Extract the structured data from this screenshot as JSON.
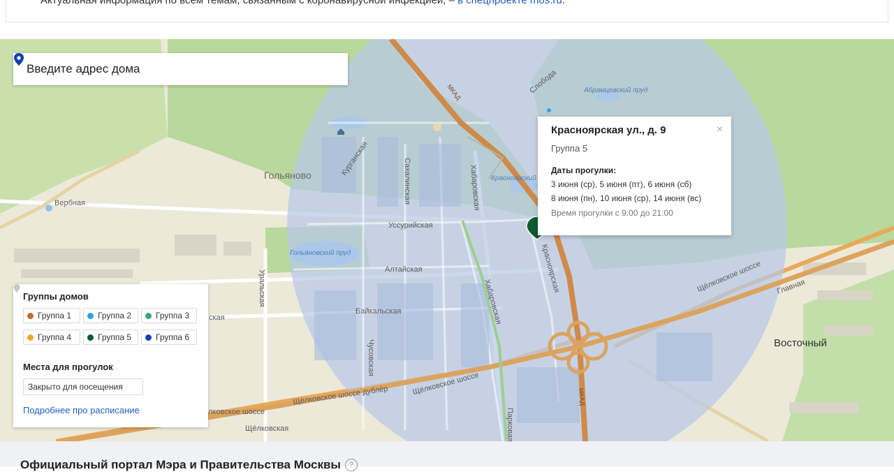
{
  "notice": {
    "text": "Актуальная информация по всем темам, связанным с коронавирусной инфекцией, –",
    "link": "в спецпроекте mos.ru",
    "tail": "."
  },
  "search": {
    "placeholder": "Введите адрес дома",
    "icon": "location-pin-icon"
  },
  "popup": {
    "title": "Красноярская ул., д. 9",
    "group": "Группа 5",
    "dates_title": "Даты прогулки:",
    "dates_line1": "3 июня (ср), 5 июня (пт), 6 июня (сб)",
    "dates_line2": "8 июня (пн), 10 июня (ср), 14 июня (вс)",
    "time": "Время прогулки с 9:00 до 21:00",
    "close": "×"
  },
  "legend": {
    "groups_title": "Группы домов",
    "groups": [
      {
        "label": "Группа 1",
        "color": "#c1692e"
      },
      {
        "label": "Группа 2",
        "color": "#2aa3e8"
      },
      {
        "label": "Группа 3",
        "color": "#3aa874"
      },
      {
        "label": "Группа 4",
        "color": "#f5a623"
      },
      {
        "label": "Группа 5",
        "color": "#0c5c2c"
      },
      {
        "label": "Группа 6",
        "color": "#1640b0"
      }
    ],
    "places_title": "Места для прогулок",
    "closed_label": "Закрыто для посещения",
    "more_link": "Подробнее про расписание"
  },
  "map_labels": {
    "golyanovo": "Гольяново",
    "vostochny": "Восточный",
    "verbnaya": "Вербная",
    "kurganskaya": "Курганская",
    "sakhalinskaya": "Сахалинская",
    "khabarovskaya": "Хабаровская",
    "khabarovskaya2": "Хабаровская",
    "ussuriyskaya": "Уссурийская",
    "altayskaya": "Алтайская",
    "baykalskaya": "Байкальская",
    "uralskaya": "Уральская",
    "chusovskaya": "Чусовская",
    "krasnoyarskaya": "Красноярская",
    "krasnoyarsky_prud": "Красноярский пруд",
    "golyanovsky_prud": "Гольяновский пруд",
    "abramtsevsky_prud": "Абрамцевский пруд",
    "sloboda": "Слобода",
    "mkad": "МКАД",
    "mkad2": "МКАД",
    "shchelkovskoe": "Щёлковское шоссе",
    "shchelkovskoe2": "Щёлковское шоссе",
    "shchelkovskoe_dubler": "Щёлковское шоссе дублёр",
    "shchelkovskoe3": "лковское шоссе",
    "shchelkovskaya": "Щёлковская",
    "glavnaya": "Главная",
    "parkovaya": "Парковая",
    "skaya": "ская"
  },
  "footer": {
    "text": "Официальный портал Мэра и Правительства Москвы",
    "help": "?"
  }
}
